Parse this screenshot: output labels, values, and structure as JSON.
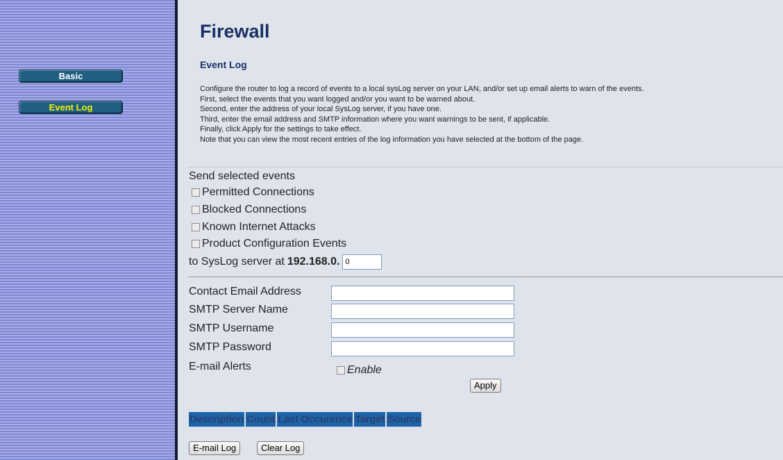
{
  "sidebar": {
    "items": [
      {
        "label": "Basic",
        "active": false
      },
      {
        "label": "Event Log",
        "active": true
      }
    ]
  },
  "header": {
    "title": "Firewall",
    "section": "Event Log"
  },
  "instructions": [
    "Configure the router to log a record of events to a local sysLog server on your LAN, and/or set up email alerts to warn of the events.",
    "First, select the events that you want logged and/or you want to be warned about.",
    "Second, enter the address of your local SysLog server, if you have one.",
    "Third, enter the email address and SMTP information where you want warnings to be sent, if applicable.",
    "Finally, click Apply for the settings to take effect.",
    "Note that you can view the most recent entries of the log information you have selected at the bottom of the page."
  ],
  "events": {
    "title": "Send selected events",
    "items": [
      {
        "label": "Permitted Connections",
        "checked": false
      },
      {
        "label": "Blocked Connections",
        "checked": false
      },
      {
        "label": "Known Internet Attacks",
        "checked": false
      },
      {
        "label": "Product Configuration Events",
        "checked": false
      }
    ]
  },
  "syslog": {
    "label": "to SysLog server at",
    "ip_prefix": "192.168.0.",
    "last_octet": "0"
  },
  "email": {
    "contact_label": "Contact Email Address",
    "contact_value": "",
    "smtp_server_label": "SMTP Server Name",
    "smtp_server_value": "",
    "smtp_user_label": "SMTP Username",
    "smtp_user_value": "",
    "smtp_pass_label": "SMTP Password",
    "smtp_pass_value": "",
    "alerts_label": "E-mail Alerts",
    "enable_label": "Enable",
    "enable_checked": false
  },
  "buttons": {
    "apply": "Apply",
    "email_log": "E-mail Log",
    "clear_log": "Clear Log"
  },
  "log_table": {
    "columns": [
      "Description",
      "Count",
      "Last Occurence",
      "Target",
      "Source"
    ]
  },
  "colors": {
    "nav_button": "#1e5f82",
    "nav_active_text": "#f5f000",
    "title_text": "#1a2f63",
    "table_header_bg": "#1c66a8"
  }
}
